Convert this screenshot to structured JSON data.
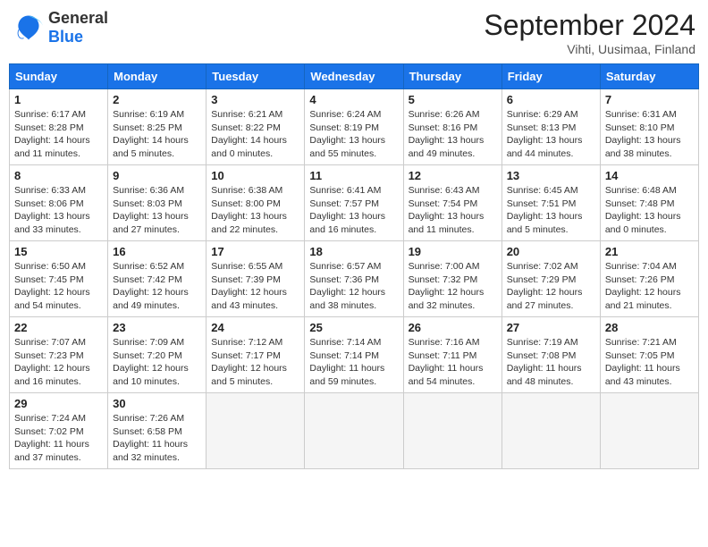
{
  "header": {
    "logo_line1": "General",
    "logo_line2": "Blue",
    "month": "September 2024",
    "location": "Vihti, Uusimaa, Finland"
  },
  "days_of_week": [
    "Sunday",
    "Monday",
    "Tuesday",
    "Wednesday",
    "Thursday",
    "Friday",
    "Saturday"
  ],
  "weeks": [
    [
      {
        "day": 1,
        "sunrise": "6:17 AM",
        "sunset": "8:28 PM",
        "daylight": "14 hours and 11 minutes."
      },
      {
        "day": 2,
        "sunrise": "6:19 AM",
        "sunset": "8:25 PM",
        "daylight": "14 hours and 5 minutes."
      },
      {
        "day": 3,
        "sunrise": "6:21 AM",
        "sunset": "8:22 PM",
        "daylight": "14 hours and 0 minutes."
      },
      {
        "day": 4,
        "sunrise": "6:24 AM",
        "sunset": "8:19 PM",
        "daylight": "13 hours and 55 minutes."
      },
      {
        "day": 5,
        "sunrise": "6:26 AM",
        "sunset": "8:16 PM",
        "daylight": "13 hours and 49 minutes."
      },
      {
        "day": 6,
        "sunrise": "6:29 AM",
        "sunset": "8:13 PM",
        "daylight": "13 hours and 44 minutes."
      },
      {
        "day": 7,
        "sunrise": "6:31 AM",
        "sunset": "8:10 PM",
        "daylight": "13 hours and 38 minutes."
      }
    ],
    [
      {
        "day": 8,
        "sunrise": "6:33 AM",
        "sunset": "8:06 PM",
        "daylight": "13 hours and 33 minutes."
      },
      {
        "day": 9,
        "sunrise": "6:36 AM",
        "sunset": "8:03 PM",
        "daylight": "13 hours and 27 minutes."
      },
      {
        "day": 10,
        "sunrise": "6:38 AM",
        "sunset": "8:00 PM",
        "daylight": "13 hours and 22 minutes."
      },
      {
        "day": 11,
        "sunrise": "6:41 AM",
        "sunset": "7:57 PM",
        "daylight": "13 hours and 16 minutes."
      },
      {
        "day": 12,
        "sunrise": "6:43 AM",
        "sunset": "7:54 PM",
        "daylight": "13 hours and 11 minutes."
      },
      {
        "day": 13,
        "sunrise": "6:45 AM",
        "sunset": "7:51 PM",
        "daylight": "13 hours and 5 minutes."
      },
      {
        "day": 14,
        "sunrise": "6:48 AM",
        "sunset": "7:48 PM",
        "daylight": "13 hours and 0 minutes."
      }
    ],
    [
      {
        "day": 15,
        "sunrise": "6:50 AM",
        "sunset": "7:45 PM",
        "daylight": "12 hours and 54 minutes."
      },
      {
        "day": 16,
        "sunrise": "6:52 AM",
        "sunset": "7:42 PM",
        "daylight": "12 hours and 49 minutes."
      },
      {
        "day": 17,
        "sunrise": "6:55 AM",
        "sunset": "7:39 PM",
        "daylight": "12 hours and 43 minutes."
      },
      {
        "day": 18,
        "sunrise": "6:57 AM",
        "sunset": "7:36 PM",
        "daylight": "12 hours and 38 minutes."
      },
      {
        "day": 19,
        "sunrise": "7:00 AM",
        "sunset": "7:32 PM",
        "daylight": "12 hours and 32 minutes."
      },
      {
        "day": 20,
        "sunrise": "7:02 AM",
        "sunset": "7:29 PM",
        "daylight": "12 hours and 27 minutes."
      },
      {
        "day": 21,
        "sunrise": "7:04 AM",
        "sunset": "7:26 PM",
        "daylight": "12 hours and 21 minutes."
      }
    ],
    [
      {
        "day": 22,
        "sunrise": "7:07 AM",
        "sunset": "7:23 PM",
        "daylight": "12 hours and 16 minutes."
      },
      {
        "day": 23,
        "sunrise": "7:09 AM",
        "sunset": "7:20 PM",
        "daylight": "12 hours and 10 minutes."
      },
      {
        "day": 24,
        "sunrise": "7:12 AM",
        "sunset": "7:17 PM",
        "daylight": "12 hours and 5 minutes."
      },
      {
        "day": 25,
        "sunrise": "7:14 AM",
        "sunset": "7:14 PM",
        "daylight": "11 hours and 59 minutes."
      },
      {
        "day": 26,
        "sunrise": "7:16 AM",
        "sunset": "7:11 PM",
        "daylight": "11 hours and 54 minutes."
      },
      {
        "day": 27,
        "sunrise": "7:19 AM",
        "sunset": "7:08 PM",
        "daylight": "11 hours and 48 minutes."
      },
      {
        "day": 28,
        "sunrise": "7:21 AM",
        "sunset": "7:05 PM",
        "daylight": "11 hours and 43 minutes."
      }
    ],
    [
      {
        "day": 29,
        "sunrise": "7:24 AM",
        "sunset": "7:02 PM",
        "daylight": "11 hours and 37 minutes."
      },
      {
        "day": 30,
        "sunrise": "7:26 AM",
        "sunset": "6:58 PM",
        "daylight": "11 hours and 32 minutes."
      },
      null,
      null,
      null,
      null,
      null
    ]
  ]
}
